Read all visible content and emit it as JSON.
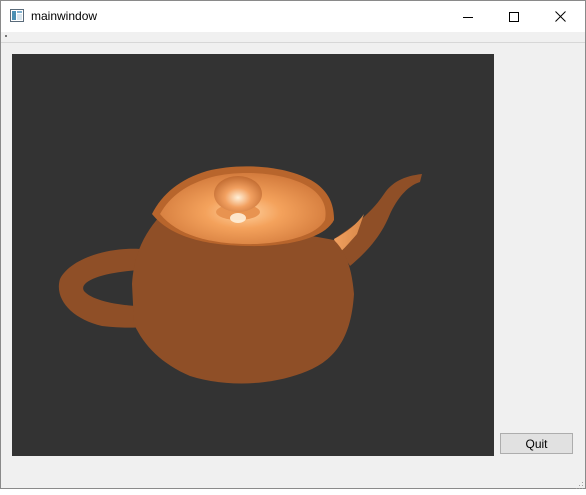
{
  "window": {
    "title": "mainwindow",
    "icons": {
      "app": "application-window-icon",
      "minimize": "minimize-icon",
      "maximize": "maximize-icon",
      "close": "close-icon"
    }
  },
  "viewport": {
    "content": "3d-teapot-render",
    "background_color": "#333333",
    "object_color": "#8f4f27",
    "highlight_color": "#f2a060"
  },
  "buttons": {
    "quit_label": "Quit"
  }
}
